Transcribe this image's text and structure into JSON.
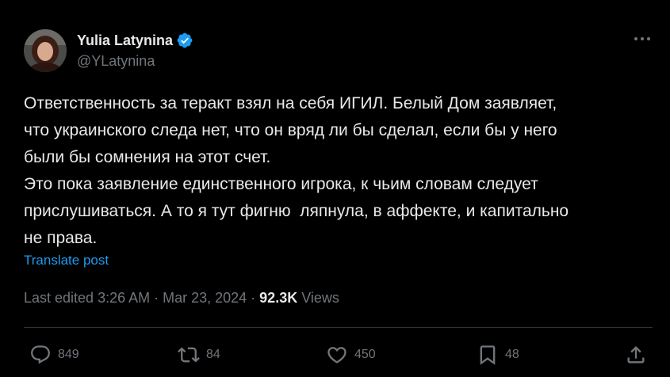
{
  "author": {
    "display_name": "Yulia Latynina",
    "handle": "@YLatynina",
    "verified_icon": "verified-badge-icon",
    "verified_color": "#1d9bf0"
  },
  "post": {
    "lines": [
      "Ответственность за теракт взял на себя ИГИЛ. Белый Дом заявляет,",
      "что украинского следа нет, что он вряд ли бы сделал, если бы у него",
      "были бы сомнения на этот счет.",
      "Это пока заявление единственного игрока, к чьим словам следует",
      "прислушиваться. А то я тут фигню  ляпнула, в аффекте, и капитально",
      "не права."
    ],
    "translate_label": "Translate post"
  },
  "meta": {
    "edited": "Last edited 3:26 AM · Mar 23, 2024 · ",
    "views_count": "92.3K",
    "views_label": " Views"
  },
  "actions": {
    "replies": "849",
    "reposts": "84",
    "likes": "450",
    "bookmarks": "48"
  },
  "colors": {
    "background": "#000000",
    "text": "#e7e9ea",
    "muted": "#71767b",
    "accent": "#1d9bf0"
  }
}
